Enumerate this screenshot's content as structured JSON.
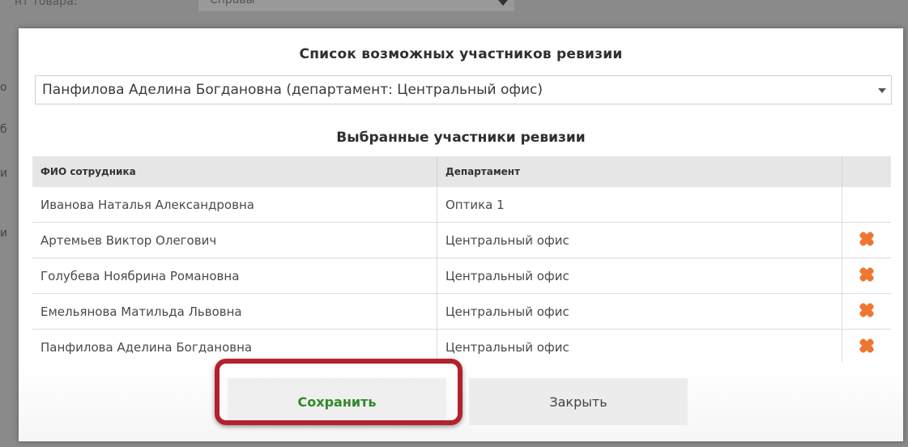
{
  "background": {
    "top_label": "нт товара:",
    "top_select": "Справы",
    "side_letters": [
      "о",
      "б",
      "и",
      "и"
    ]
  },
  "modal": {
    "title": "Список возможных участников ревизии",
    "select_value": "Панфилова Аделина Богдановна (департамент: Центральный офис)",
    "section_title": "Выбранные участники ревизии",
    "table": {
      "headers": [
        "ФИО сотрудника",
        "Департамент"
      ],
      "rows": [
        {
          "name": "Иванова Наталья Александровна",
          "department": "Оптика 1",
          "deletable": false
        },
        {
          "name": "Артемьев Виктор Олегович",
          "department": "Центральный офис",
          "deletable": true
        },
        {
          "name": "Голубева Ноябрина Романовна",
          "department": "Центральный офис",
          "deletable": true
        },
        {
          "name": "Емельянова Матильда Львовна",
          "department": "Центральный офис",
          "deletable": true
        },
        {
          "name": "Панфилова Аделина Богдановна",
          "department": "Центральный офис",
          "deletable": true
        }
      ]
    },
    "buttons": {
      "save": "Сохранить",
      "close": "Закрыть"
    }
  },
  "colors": {
    "accent_save": "#2f8a27",
    "delete_icon": "#ef7630",
    "highlight": "#b3212b"
  },
  "icons": {
    "delete": "delete-x-icon",
    "dropdown": "chevron-down-icon"
  }
}
